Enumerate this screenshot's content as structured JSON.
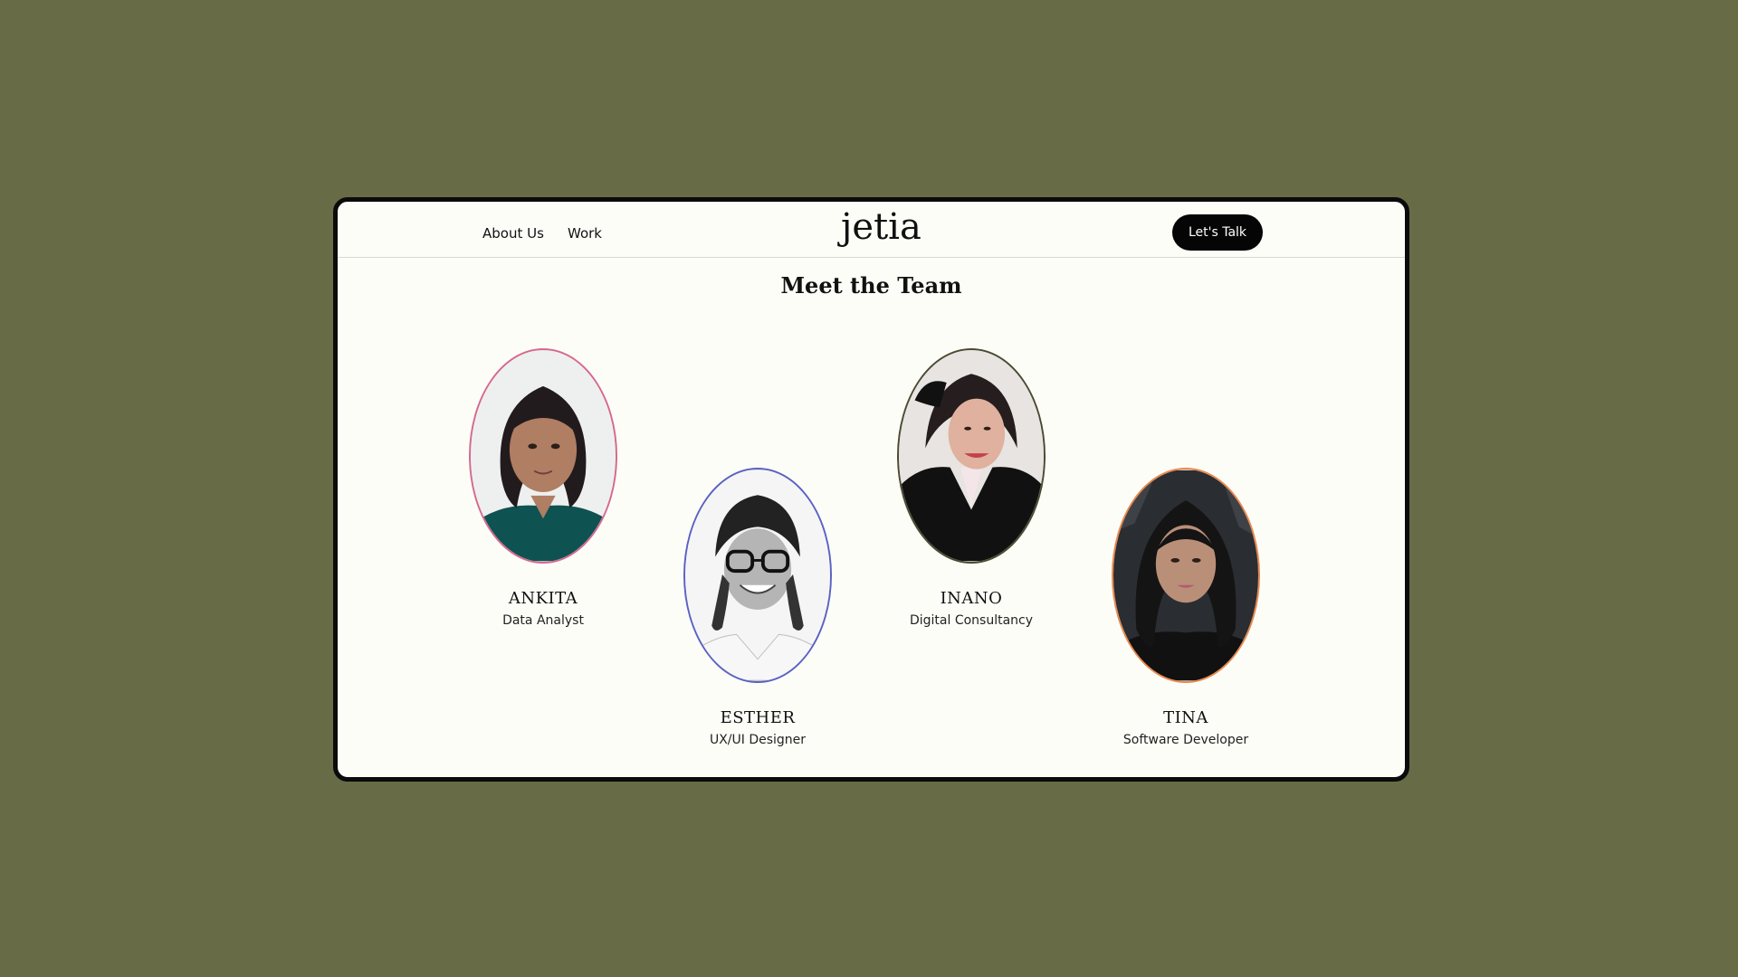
{
  "header": {
    "nav": [
      {
        "label": "About Us"
      },
      {
        "label": "Work"
      }
    ],
    "logo_text": "jetia",
    "cta_label": "Let's Talk"
  },
  "section": {
    "title": "Meet the Team"
  },
  "team": [
    {
      "name": "ANKITA",
      "role": "Data Analyst",
      "border_color": "#d56a8f"
    },
    {
      "name": "ESTHER",
      "role": "UX/UI Designer",
      "border_color": "#5a62c4"
    },
    {
      "name": "INANO",
      "role": "Digital Consultancy",
      "border_color": "#4b4b33"
    },
    {
      "name": "TINA",
      "role": "Software Developer",
      "border_color": "#e88a4e"
    }
  ],
  "colors": {
    "page_background": "#676c47",
    "card_background": "#fdfdf8",
    "button_background": "#050505"
  }
}
